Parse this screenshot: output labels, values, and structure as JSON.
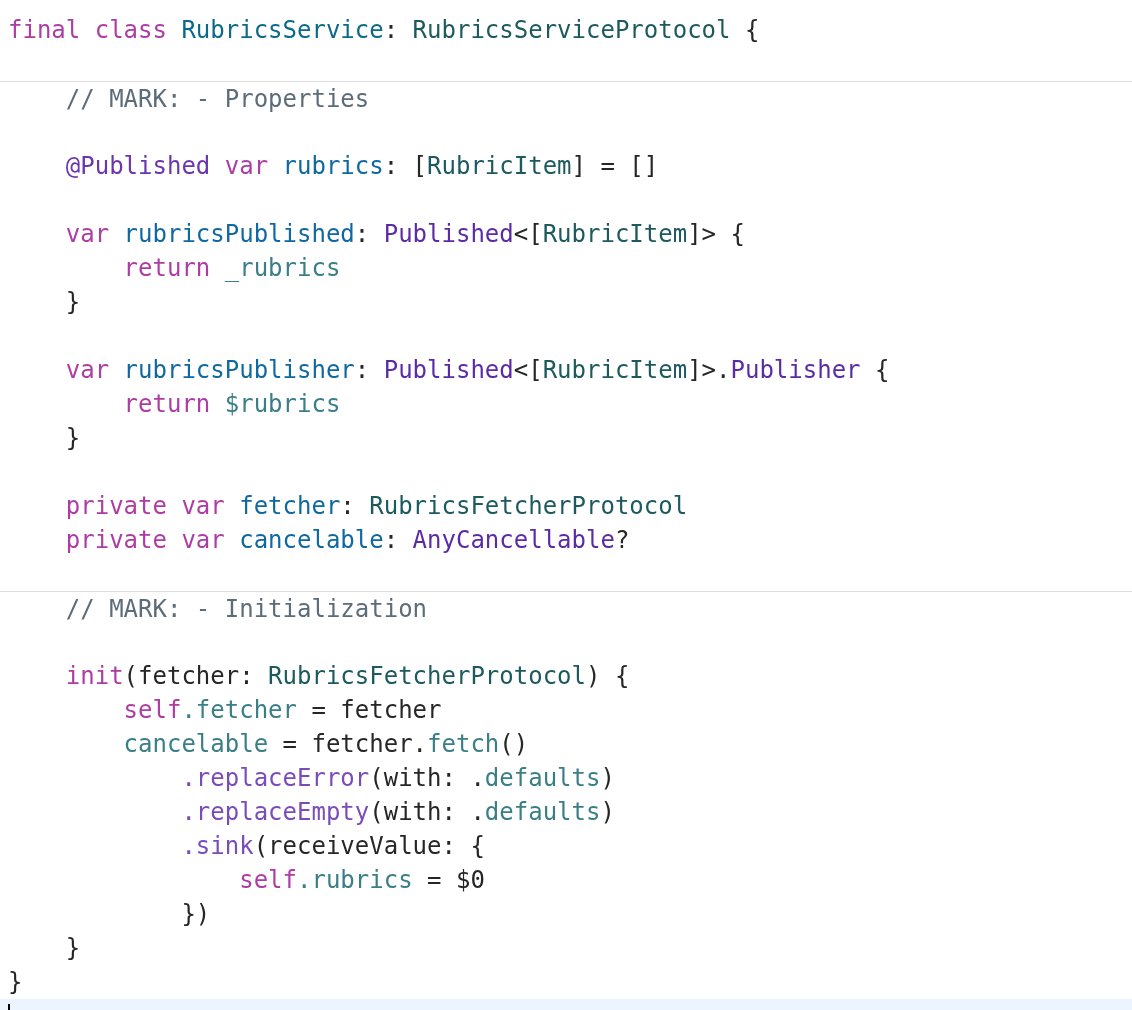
{
  "editor": {
    "lines": [
      {
        "kind": "code",
        "current": false,
        "tokens": [
          {
            "kind": "kw",
            "text": "final class "
          },
          {
            "kind": "decl_type",
            "text": "RubricsService"
          },
          {
            "kind": "p",
            "text": ": "
          },
          {
            "kind": "proj_type",
            "text": "RubricsServiceProtocol"
          },
          {
            "kind": "p",
            "text": " {"
          }
        ],
        "children": [
          {
            "kind": "blank",
            "current": false
          },
          {
            "kind": "mark",
            "current": false,
            "tokens": [
              {
                "kind": "comment",
                "text": "// MARK: - Properties"
              }
            ]
          },
          {
            "kind": "blank",
            "current": false
          },
          {
            "kind": "code",
            "current": false,
            "tokens": [
              {
                "kind": "attr",
                "text": "@Published "
              },
              {
                "kind": "kw",
                "text": "var "
              },
              {
                "kind": "decl",
                "text": "rubrics"
              },
              {
                "kind": "p",
                "text": ": ["
              },
              {
                "kind": "proj_type",
                "text": "RubricItem"
              },
              {
                "kind": "p",
                "text": "] = []"
              }
            ]
          },
          {
            "kind": "blank",
            "current": false
          },
          {
            "kind": "code",
            "current": false,
            "tokens": [
              {
                "kind": "kw",
                "text": "var "
              },
              {
                "kind": "decl",
                "text": "rubricsPublished"
              },
              {
                "kind": "p",
                "text": ": "
              },
              {
                "kind": "sys_type",
                "text": "Published"
              },
              {
                "kind": "p",
                "text": "<["
              },
              {
                "kind": "proj_type",
                "text": "RubricItem"
              },
              {
                "kind": "p",
                "text": "]> {"
              }
            ],
            "children": [
              {
                "kind": "code",
                "current": false,
                "tokens": [
                  {
                    "kind": "kw",
                    "text": "return "
                  },
                  {
                    "kind": "proj_member",
                    "text": "_rubrics"
                  }
                ]
              }
            ]
          },
          {
            "kind": "code",
            "current": false,
            "tokens": [
              {
                "kind": "p",
                "text": "}"
              }
            ]
          },
          {
            "kind": "blank",
            "current": false
          },
          {
            "kind": "code",
            "current": false,
            "tokens": [
              {
                "kind": "kw",
                "text": "var "
              },
              {
                "kind": "decl",
                "text": "rubricsPublisher"
              },
              {
                "kind": "p",
                "text": ": "
              },
              {
                "kind": "sys_type",
                "text": "Published"
              },
              {
                "kind": "p",
                "text": "<["
              },
              {
                "kind": "proj_type",
                "text": "RubricItem"
              },
              {
                "kind": "p",
                "text": "]>."
              },
              {
                "kind": "sys_type",
                "text": "Publisher"
              },
              {
                "kind": "p",
                "text": " {"
              }
            ],
            "children": [
              {
                "kind": "code",
                "current": false,
                "tokens": [
                  {
                    "kind": "kw",
                    "text": "return "
                  },
                  {
                    "kind": "proj_member",
                    "text": "$rubrics"
                  }
                ]
              }
            ]
          },
          {
            "kind": "code",
            "current": false,
            "tokens": [
              {
                "kind": "p",
                "text": "}"
              }
            ]
          },
          {
            "kind": "blank",
            "current": false
          },
          {
            "kind": "code",
            "current": false,
            "tokens": [
              {
                "kind": "kw",
                "text": "private var "
              },
              {
                "kind": "decl",
                "text": "fetcher"
              },
              {
                "kind": "p",
                "text": ": "
              },
              {
                "kind": "proj_type",
                "text": "RubricsFetcherProtocol"
              }
            ]
          },
          {
            "kind": "code",
            "current": false,
            "tokens": [
              {
                "kind": "kw",
                "text": "private var "
              },
              {
                "kind": "decl",
                "text": "cancelable"
              },
              {
                "kind": "p",
                "text": ": "
              },
              {
                "kind": "sys_type",
                "text": "AnyCancellable"
              },
              {
                "kind": "p",
                "text": "?"
              }
            ]
          },
          {
            "kind": "blank",
            "current": false
          },
          {
            "kind": "mark",
            "current": false,
            "tokens": [
              {
                "kind": "comment",
                "text": "// MARK: - Initialization"
              }
            ]
          },
          {
            "kind": "blank",
            "current": false
          },
          {
            "kind": "code",
            "current": false,
            "tokens": [
              {
                "kind": "kw",
                "text": "init"
              },
              {
                "kind": "p",
                "text": "(fetcher: "
              },
              {
                "kind": "proj_type",
                "text": "RubricsFetcherProtocol"
              },
              {
                "kind": "p",
                "text": ") {"
              }
            ],
            "children": [
              {
                "kind": "code",
                "current": false,
                "tokens": [
                  {
                    "kind": "kw",
                    "text": "self"
                  },
                  {
                    "kind": "proj_member",
                    "text": ".fetcher"
                  },
                  {
                    "kind": "p",
                    "text": " = fetcher"
                  }
                ]
              },
              {
                "kind": "code",
                "current": false,
                "tokens": [
                  {
                    "kind": "proj_member",
                    "text": "cancelable"
                  },
                  {
                    "kind": "p",
                    "text": " = fetcher."
                  },
                  {
                    "kind": "proj_member",
                    "text": "fetch"
                  },
                  {
                    "kind": "p",
                    "text": "()"
                  }
                ],
                "children": [
                  {
                    "kind": "code",
                    "current": false,
                    "tokens": [
                      {
                        "kind": "sys_func",
                        "text": ".replaceError"
                      },
                      {
                        "kind": "p",
                        "text": "(with: ."
                      },
                      {
                        "kind": "proj_member",
                        "text": "defaults"
                      },
                      {
                        "kind": "p",
                        "text": ")"
                      }
                    ]
                  },
                  {
                    "kind": "code",
                    "current": false,
                    "tokens": [
                      {
                        "kind": "sys_func",
                        "text": ".replaceEmpty"
                      },
                      {
                        "kind": "p",
                        "text": "(with: ."
                      },
                      {
                        "kind": "proj_member",
                        "text": "defaults"
                      },
                      {
                        "kind": "p",
                        "text": ")"
                      }
                    ]
                  },
                  {
                    "kind": "code",
                    "current": false,
                    "tokens": [
                      {
                        "kind": "sys_func",
                        "text": ".sink"
                      },
                      {
                        "kind": "p",
                        "text": "(receiveValue: {"
                      }
                    ],
                    "children": [
                      {
                        "kind": "code",
                        "current": false,
                        "tokens": [
                          {
                            "kind": "kw",
                            "text": "self"
                          },
                          {
                            "kind": "proj_member",
                            "text": ".rubrics"
                          },
                          {
                            "kind": "p",
                            "text": " = $0"
                          }
                        ]
                      }
                    ]
                  },
                  {
                    "kind": "code",
                    "current": false,
                    "tokens": [
                      {
                        "kind": "p",
                        "text": "})"
                      }
                    ]
                  }
                ]
              }
            ]
          },
          {
            "kind": "code",
            "current": false,
            "tokens": [
              {
                "kind": "p",
                "text": "}"
              }
            ]
          }
        ]
      },
      {
        "kind": "code",
        "current": false,
        "tokens": [
          {
            "kind": "p",
            "text": "}"
          }
        ]
      },
      {
        "kind": "blank",
        "current": true
      }
    ]
  }
}
